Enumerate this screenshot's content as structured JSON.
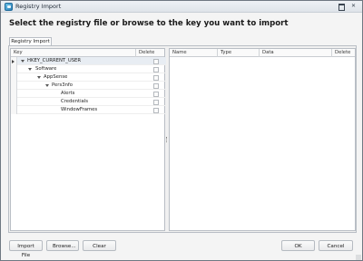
{
  "window": {
    "title": "Registry Import",
    "maximize_glyph": "",
    "close_glyph": "✕",
    "app_icon": "registry-import-icon"
  },
  "heading": "Select the registry file or browse to the key you want to import",
  "tabs": [
    {
      "label": "Registry Import"
    }
  ],
  "tree": {
    "columns": {
      "key": "Key",
      "delete": "Delete"
    },
    "rows": [
      {
        "label": "HKEY_CURRENT_USER",
        "expanded": true,
        "selected": true
      },
      {
        "label": "Software",
        "expanded": true
      },
      {
        "label": "AppSense",
        "expanded": true
      },
      {
        "label": "Pers3nfo",
        "expanded": true
      },
      {
        "label": "Alerts"
      },
      {
        "label": "Credentials"
      },
      {
        "label": "WindowFrames"
      }
    ]
  },
  "values_grid": {
    "columns": {
      "name": "Name",
      "type": "Type",
      "data": "Data",
      "delete": "Delete"
    }
  },
  "buttons": {
    "import_file": "Import File",
    "browse": "Browse...",
    "clear": "Clear",
    "ok": "OK",
    "cancel": "Cancel"
  },
  "colors": {
    "accent": "#2a7fb8",
    "selected_row": "#e8edf3"
  }
}
